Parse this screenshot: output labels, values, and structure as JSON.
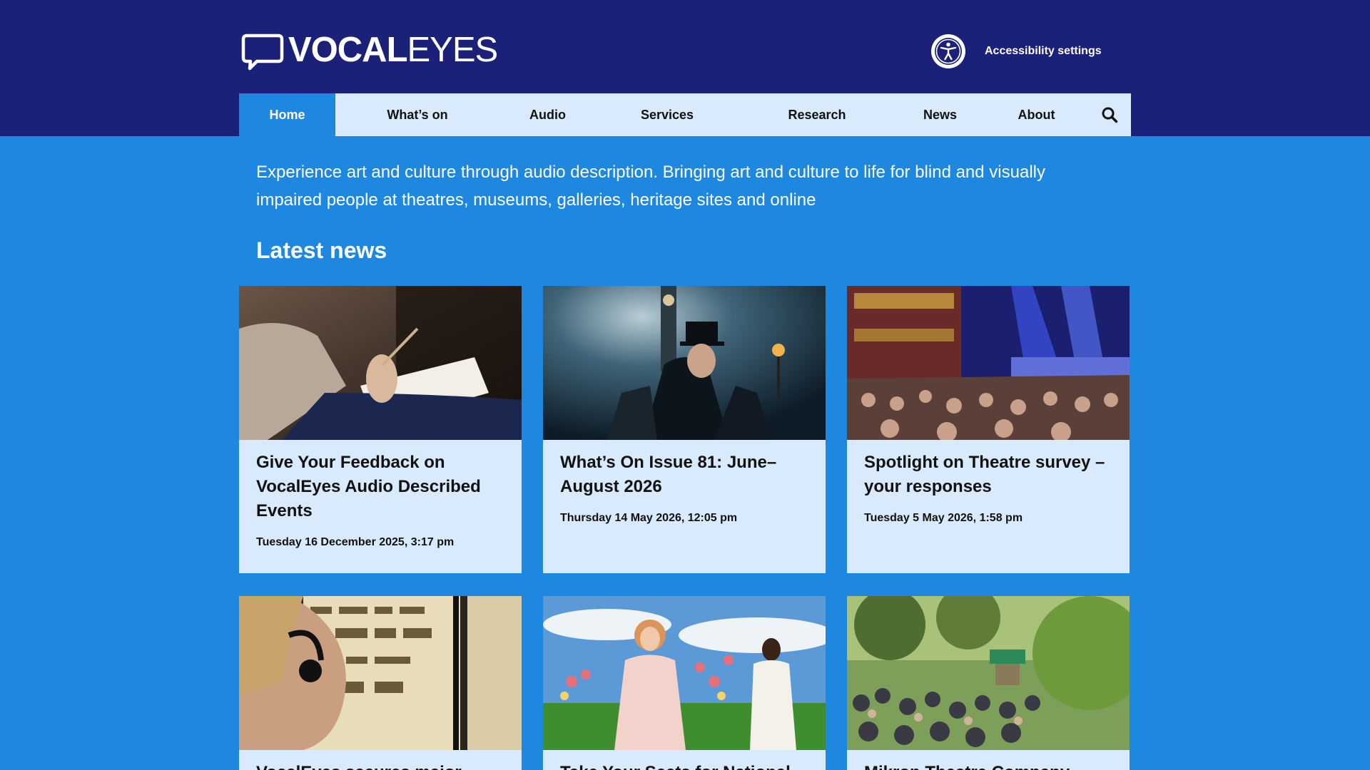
{
  "brand": {
    "logo_bold": "VOCAL",
    "logo_light": "EYES"
  },
  "header": {
    "accessibility_label": "Accessibility settings"
  },
  "nav": {
    "items": [
      {
        "label": "Home",
        "active": true
      },
      {
        "label": "What’s on"
      },
      {
        "label": "Audio"
      },
      {
        "label": "Services"
      },
      {
        "label": "Research"
      },
      {
        "label": "News"
      },
      {
        "label": "About"
      }
    ],
    "search_icon": "search-icon"
  },
  "intro": "Experience art and culture through audio description. Bringing art and culture to life for blind and visually impaired people at theatres, museums, galleries, heritage sites and online",
  "latest_news": {
    "heading": "Latest news",
    "cards": [
      {
        "title": "Give Your Feedback on VocalEyes Audio Described Events",
        "date": "Tuesday 16 December 2025, 3:17 pm"
      },
      {
        "title": "What’s On Issue 81: June–August 2026",
        "date": "Thursday 14 May 2026, 12:05 pm"
      },
      {
        "title": "Spotlight on Theatre survey – your responses",
        "date": "Tuesday 5 May 2026, 1:58 pm"
      },
      {
        "title": "VocalEyes secures major",
        "date": ""
      },
      {
        "title": "Take Your Seats for National",
        "date": ""
      },
      {
        "title": "Mikron Theatre Company",
        "date": ""
      }
    ]
  },
  "colors": {
    "masthead": "#1b2179",
    "page_background": "#1e88e0",
    "nav_background": "#d8eafb",
    "card_background": "#d8eafb"
  }
}
